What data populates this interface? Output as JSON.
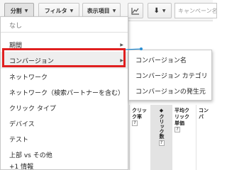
{
  "toolbar": {
    "segment_label": "分割",
    "filter_label": "フィルタ",
    "columns_label": "表示項目",
    "chart_icon": "line-chart-icon",
    "download_icon": "download-icon",
    "search_placeholder": "キャンペーン名"
  },
  "menu": {
    "items": [
      {
        "label": "なし"
      },
      {
        "label": "期間"
      },
      {
        "label": "コンバージョン"
      },
      {
        "label": "ネットワーク"
      },
      {
        "label": "ネットワーク（検索パートナーを含む）"
      },
      {
        "label": "クリック タイプ"
      },
      {
        "label": "デバイス"
      },
      {
        "label": "テスト"
      },
      {
        "label": "上部 vs その他"
      },
      {
        "label": "+1 情報"
      }
    ]
  },
  "submenu": {
    "items": [
      {
        "label": "コンバージョン名"
      },
      {
        "label": "コンバージョン カテゴリ"
      },
      {
        "label": "コンバージョンの発生元"
      }
    ]
  },
  "table": {
    "columns": [
      {
        "label": "クリック率"
      },
      {
        "label": "クリック数"
      },
      {
        "label": "平均クリック単価"
      },
      {
        "label": "コンバ"
      }
    ],
    "sort_indicator": "◆",
    "help_mark": "?"
  },
  "colors": {
    "highlight_border": "#e02020",
    "connector": "#2a8fd4"
  }
}
